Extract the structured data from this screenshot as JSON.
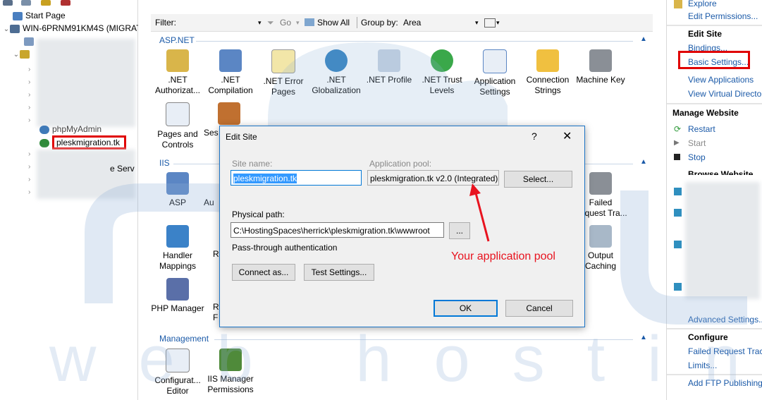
{
  "tree": {
    "start_page": "Start Page",
    "server_node": "WIN-6PRNM91KM4S (MIGRAT",
    "phpmyadmin": "phpMyAdmin",
    "selected_site": "pleskmigration.tk",
    "partial_text": "e Serv"
  },
  "filter_bar": {
    "filter_label": "Filter:",
    "go_label": "Go",
    "show_all_label": "Show All",
    "group_by_label": "Group by:",
    "group_by_value": "Area"
  },
  "sections": {
    "aspnet": "ASP.NET",
    "iis": "IIS",
    "management": "Management"
  },
  "aspnet_features": [
    {
      "label": ".NET Authorizat...",
      "icon": "net-authorization-icon"
    },
    {
      "label": ".NET Compilation",
      "icon": "net-compilation-icon"
    },
    {
      "label": ".NET Error Pages",
      "icon": "net-error-pages-icon"
    },
    {
      "label": ".NET Globalization",
      "icon": "net-globalization-icon"
    },
    {
      "label": ".NET Profile",
      "icon": "net-profile-icon"
    },
    {
      "label": ".NET Trust Levels",
      "icon": "net-trust-levels-icon"
    },
    {
      "label": "Application Settings",
      "icon": "application-settings-icon"
    },
    {
      "label": "Connection Strings",
      "icon": "connection-strings-icon"
    },
    {
      "label": "Machine Key",
      "icon": "machine-key-icon"
    },
    {
      "label": "Pages and Controls",
      "icon": "pages-controls-icon"
    },
    {
      "label": "Ses",
      "icon": "session-state-icon"
    }
  ],
  "iis_features": [
    {
      "label": "ASP",
      "icon": "asp-icon"
    },
    {
      "label": "Au",
      "icon": "authentication-icon"
    },
    {
      "label": "Handler Mappings",
      "icon": "handler-mappings-icon"
    },
    {
      "label": "R",
      "icon": "r-icon"
    },
    {
      "label": "PHP Manager",
      "icon": "php-manager-icon"
    },
    {
      "label": "R F",
      "icon": "rf-icon"
    },
    {
      "label": "Failed Request Tra...",
      "icon": "failed-request-icon"
    },
    {
      "label": "Output Caching",
      "icon": "output-caching-icon"
    }
  ],
  "management_features": [
    {
      "label": "Configurat... Editor",
      "icon": "configuration-editor-icon"
    },
    {
      "label": "IIS Manager Permissions",
      "icon": "iis-manager-permissions-icon"
    }
  ],
  "actions": {
    "explore": "Explore",
    "edit_permissions": "Edit Permissions...",
    "edit_site_header": "Edit Site",
    "bindings": "Bindings...",
    "basic_settings": "Basic Settings...",
    "view_applications": "View Applications",
    "view_virtual_directories": "View Virtual Director",
    "manage_website_header": "Manage Website",
    "restart": "Restart",
    "start": "Start",
    "stop": "Stop",
    "browse_website_header": "Browse Website",
    "advanced_settings": "Advanced Settings...",
    "configure_header": "Configure",
    "failed_request_tracing": "Failed Request Tracin",
    "limits": "Limits...",
    "add_ftp": "Add FTP Publishing..."
  },
  "dialog": {
    "title": "Edit Site",
    "help": "?",
    "close": "✕",
    "site_name_label": "Site name:",
    "site_name_value": "pleskmigration.tk",
    "app_pool_label": "Application pool:",
    "app_pool_value": "pleskmigration.tk v2.0 (Integrated)",
    "select_button": "Select...",
    "physical_path_label": "Physical path:",
    "physical_path_value": "C:\\HostingSpaces\\herrick\\pleskmigration.tk\\wwwroot",
    "browse_button": "...",
    "passthrough_label": "Pass-through authentication",
    "connect_as_button": "Connect as...",
    "test_settings_button": "Test Settings...",
    "ok_button": "OK",
    "cancel_button": "Cancel"
  },
  "annotation": {
    "text": "Your application pool",
    "color": "#e8131f"
  },
  "watermark": {
    "text": "web hosting",
    "color": "#8fb0d6"
  },
  "colors": {
    "link": "#1b5aa8",
    "highlight_box": "#e00000",
    "dialog_border": "#1c74c6"
  }
}
